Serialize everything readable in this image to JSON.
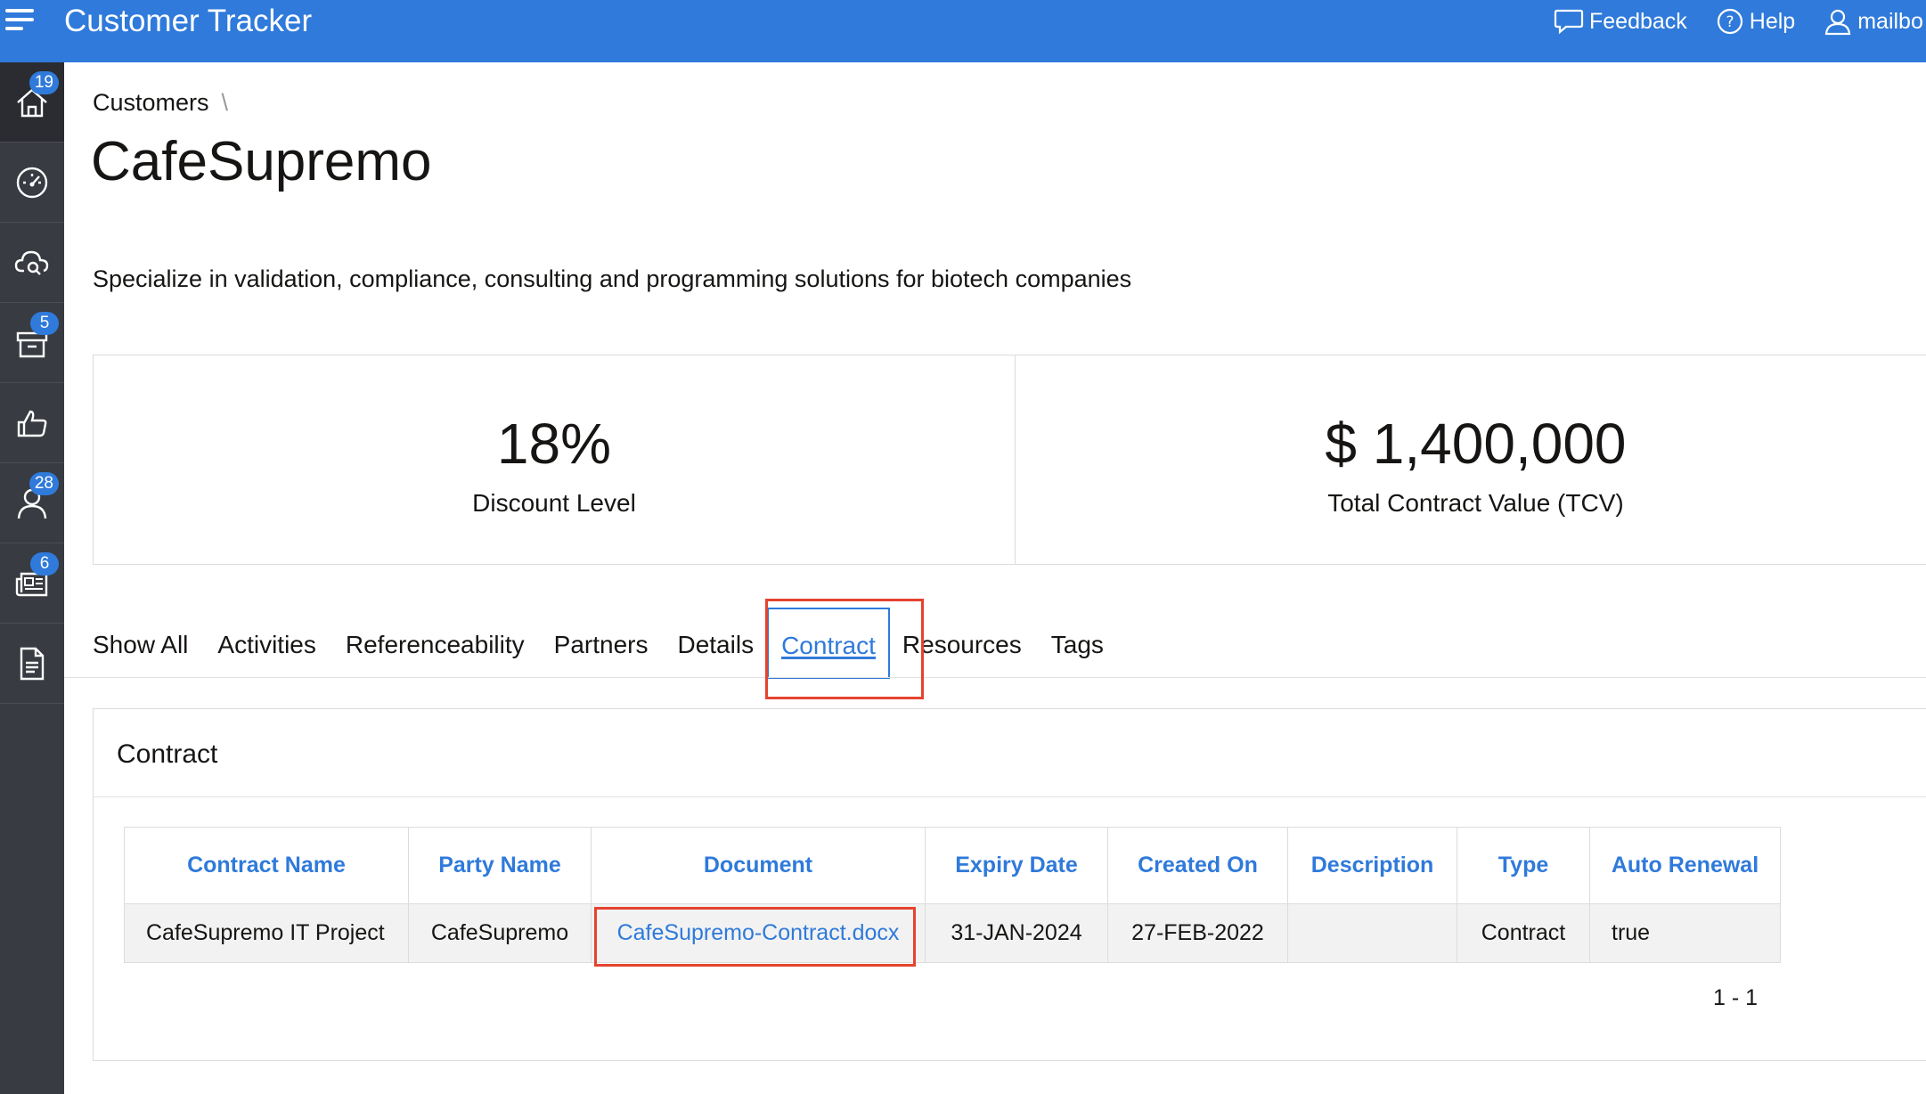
{
  "header": {
    "app_title": "Customer Tracker",
    "actions": [
      {
        "label": "Feedback",
        "icon": "feedback-icon"
      },
      {
        "label": "Help",
        "icon": "help-icon"
      },
      {
        "label": "mailbo",
        "icon": "user-icon"
      }
    ]
  },
  "sidebar": {
    "items": [
      {
        "icon": "home-icon",
        "badge": "19",
        "active": true
      },
      {
        "icon": "dashboard-icon",
        "badge": ""
      },
      {
        "icon": "cloud-search-icon",
        "badge": ""
      },
      {
        "icon": "archive-icon",
        "badge": "5"
      },
      {
        "icon": "thumbs-up-icon",
        "badge": ""
      },
      {
        "icon": "user-icon",
        "badge": "28"
      },
      {
        "icon": "newspaper-icon",
        "badge": "6"
      },
      {
        "icon": "document-icon",
        "badge": ""
      }
    ]
  },
  "breadcrumb": {
    "parent": "Customers",
    "separator": "\\"
  },
  "page": {
    "title": "CafeSupremo",
    "description": "Specialize in validation, compliance, consulting and programming solutions for biotech companies"
  },
  "metrics": [
    {
      "value": "18%",
      "label": "Discount Level"
    },
    {
      "value": "$ 1,400,000",
      "label": "Total Contract Value (TCV)"
    }
  ],
  "tabs": [
    {
      "label": "Show All"
    },
    {
      "label": "Activities"
    },
    {
      "label": "Referenceability"
    },
    {
      "label": "Partners"
    },
    {
      "label": "Details"
    },
    {
      "label": "Contract",
      "selected": true
    },
    {
      "label": "Resources"
    },
    {
      "label": "Tags"
    }
  ],
  "contract_region": {
    "title": "Contract",
    "columns": [
      "Contract Name",
      "Party Name",
      "Document",
      "Expiry Date",
      "Created On",
      "Description",
      "Type",
      "Auto Renewal"
    ],
    "rows": [
      [
        "CafeSupremo IT Project",
        "CafeSupremo",
        "CafeSupremo-Contract.docx",
        "31-JAN-2024",
        "27-FEB-2022",
        "",
        "Contract",
        "true"
      ]
    ],
    "pagination": "1 - 1"
  },
  "colors": {
    "brand": "#2f7ada",
    "sidebar": "#383b41",
    "highlight": "#e5432f"
  }
}
